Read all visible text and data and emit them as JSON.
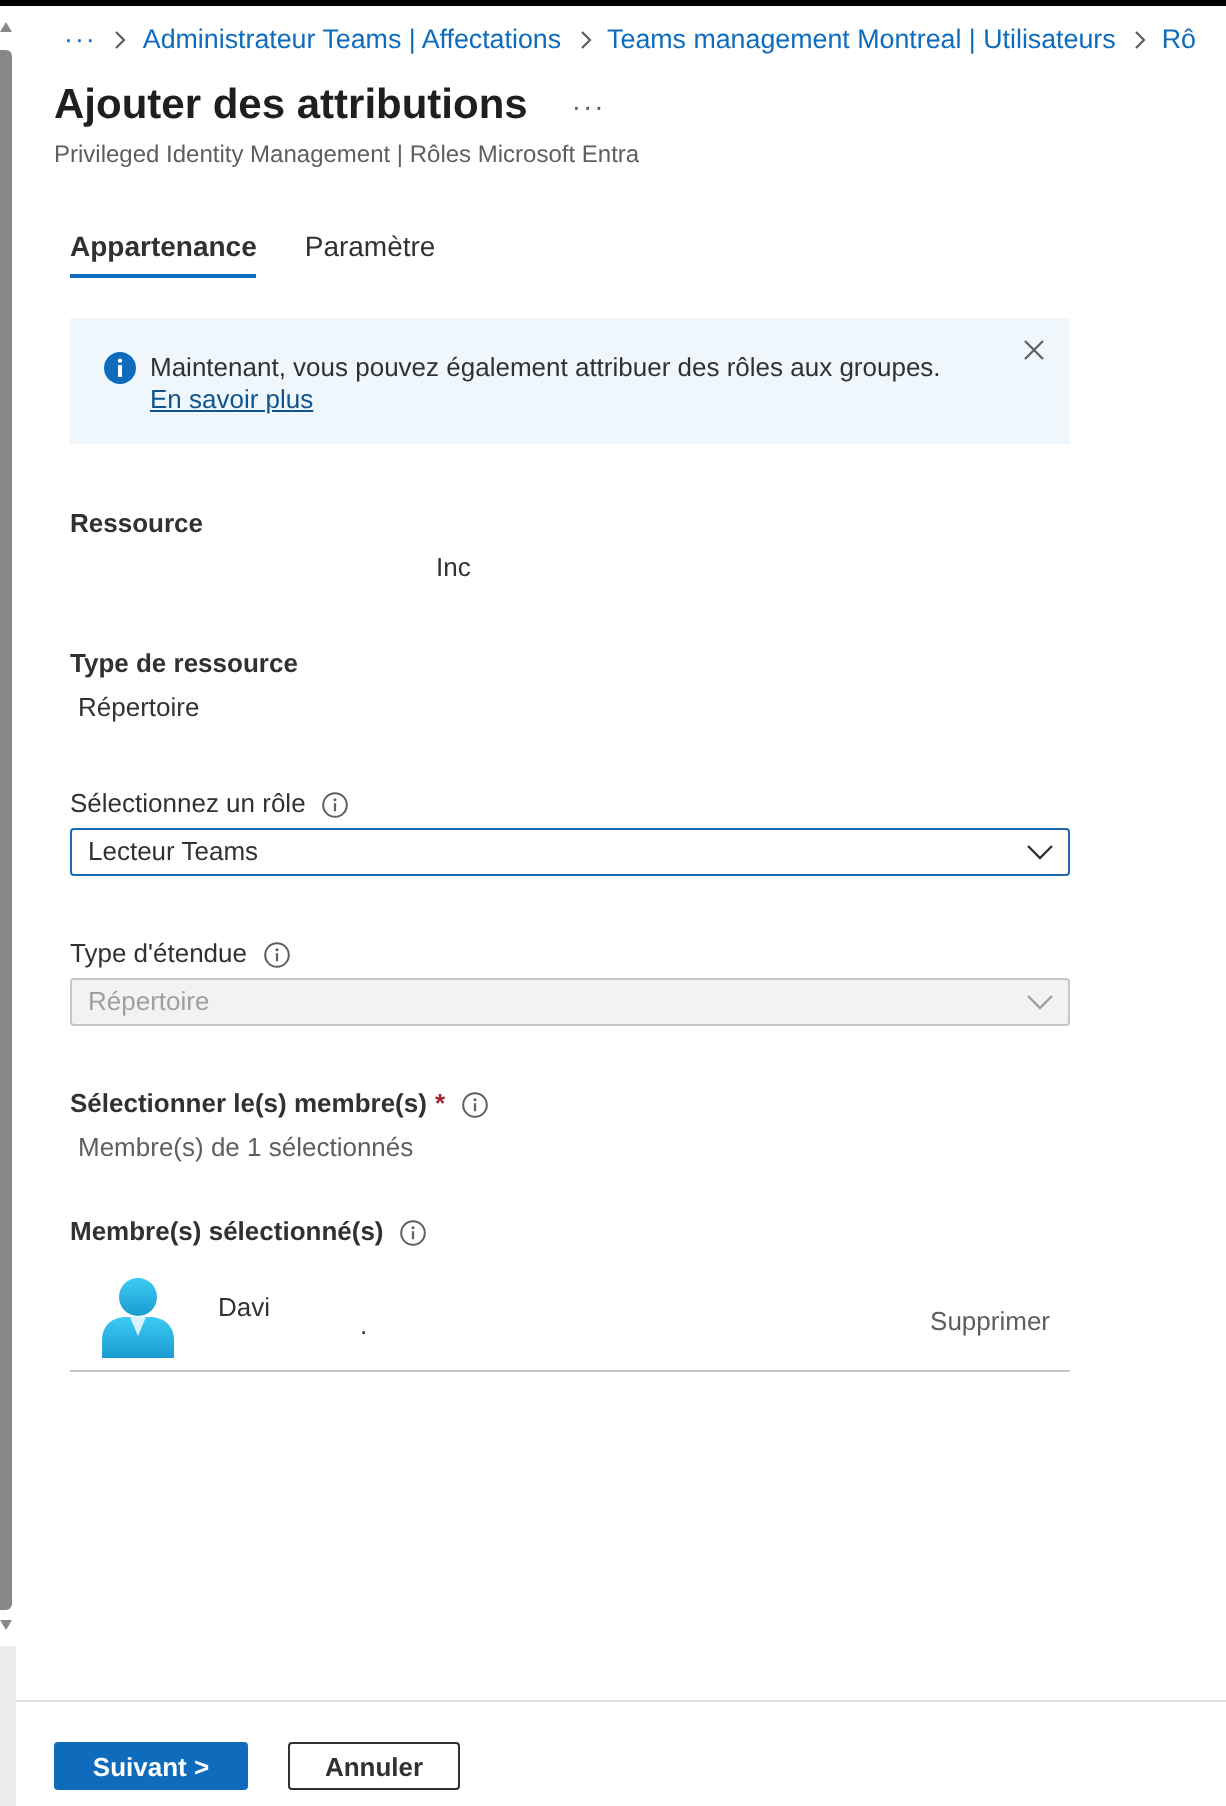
{
  "breadcrumb": {
    "more": "···",
    "items": [
      "Administrateur Teams | Affectations",
      "Teams management Montreal | Utilisateurs",
      "Rô"
    ]
  },
  "header": {
    "title": "Ajouter des attributions",
    "more": "···",
    "subtitle": "Privileged Identity Management | Rôles Microsoft Entra"
  },
  "tabs": [
    {
      "label": "Appartenance",
      "selected": true
    },
    {
      "label": "Paramètre",
      "selected": false
    }
  ],
  "banner": {
    "text": "Maintenant, vous pouvez également attribuer des rôles aux groupes.",
    "link": "En savoir plus"
  },
  "fields": [
    {
      "kind": "static",
      "label": "Ressource",
      "info": false,
      "value": "Inc"
    },
    {
      "kind": "static",
      "label": "Type de ressource",
      "info": false,
      "value": "Répertoire"
    },
    {
      "kind": "dropdown",
      "label": "Sélectionnez un rôle",
      "info": true,
      "value": "Lecteur Teams",
      "disabled": false
    },
    {
      "kind": "dropdown",
      "label": "Type d'étendue",
      "info": true,
      "value": "Répertoire",
      "disabled": true
    },
    {
      "kind": "picker",
      "label": "Sélectionner le(s) membre(s)",
      "required_mark": "*",
      "info": true,
      "value": "Membre(s) de 1 sélectionnés"
    }
  ],
  "selected_members": {
    "label": "Membre(s) sélectionné(s)",
    "info": true,
    "members": [
      {
        "name": "Davi",
        "detail": ".",
        "action": "Supprimer"
      }
    ]
  },
  "footer": {
    "buttons": [
      {
        "label": "Suivant >",
        "kind": "primary"
      },
      {
        "label": "Annuler",
        "kind": "secondary"
      }
    ]
  }
}
